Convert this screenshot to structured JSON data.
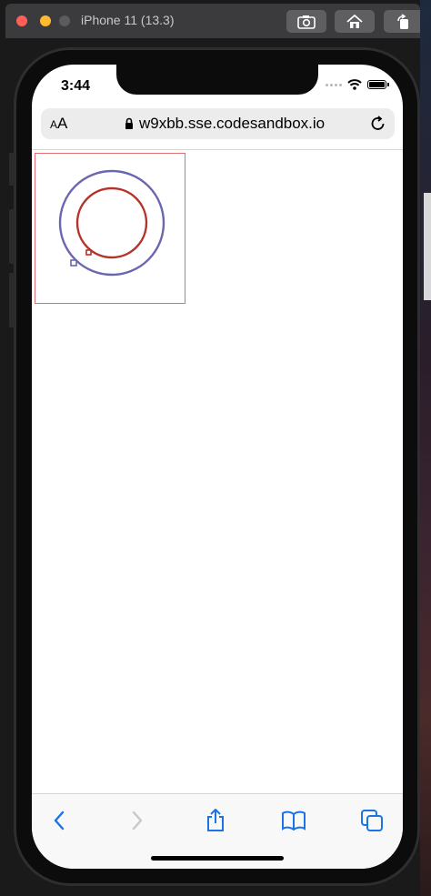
{
  "simulator": {
    "title": "iPhone 11 (13.3)",
    "buttons": [
      "screenshot-icon",
      "home-icon",
      "rotate-icon"
    ]
  },
  "status_bar": {
    "time": "3:44"
  },
  "browser": {
    "text_size_label_small": "A",
    "text_size_label_large": "A",
    "url": "w9xbb.sse.codesandbox.io",
    "toolbar_icons": [
      "back-icon",
      "forward-icon",
      "share-icon",
      "bookmarks-icon",
      "tabs-icon"
    ]
  },
  "page": {
    "outer_circle_color": "#6b66b0",
    "inner_circle_color": "#b5342a",
    "frame_color": "#e07070"
  },
  "colors": {
    "accent": "#1a73e8",
    "disabled": "#c8c8cc"
  }
}
